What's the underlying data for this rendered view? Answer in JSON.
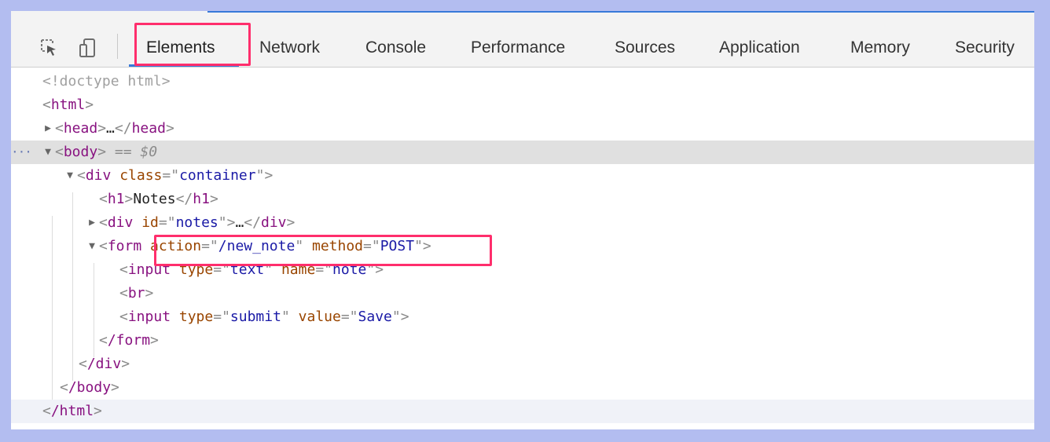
{
  "devtools": {
    "tabs": [
      {
        "label": "Elements",
        "active": true
      },
      {
        "label": "Network"
      },
      {
        "label": "Console"
      },
      {
        "label": "Performance"
      },
      {
        "label": "Sources"
      },
      {
        "label": "Application"
      },
      {
        "label": "Memory"
      },
      {
        "label": "Security"
      }
    ],
    "icons": [
      "inspect-element-icon",
      "device-toolbar-icon"
    ],
    "accent_color": "#3879d9",
    "highlight_color": "#ff2e6c"
  },
  "tree": {
    "doctype": "<!doctype html>",
    "html_open": {
      "tag": "html"
    },
    "head": {
      "tag": "head",
      "ellipsis": "…"
    },
    "body": {
      "tag": "body",
      "selected_marker": " == ",
      "var": "$0"
    },
    "container_div": {
      "tag": "div",
      "attr_name": "class",
      "attr_value": "container"
    },
    "h1": {
      "tag": "h1",
      "text": "Notes"
    },
    "notes_div": {
      "tag": "div",
      "attr_name": "id",
      "attr_value": "notes",
      "ellipsis": "…"
    },
    "form": {
      "tag": "form",
      "attr1_name": "action",
      "attr1_value": "/new_note",
      "attr2_name": "method",
      "attr2_value": "POST"
    },
    "input_text": {
      "tag": "input",
      "attr1_name": "type",
      "attr1_value": "text",
      "attr2_name": "name",
      "attr2_value": "note"
    },
    "br": {
      "tag": "br"
    },
    "input_submit": {
      "tag": "input",
      "attr1_name": "type",
      "attr1_value": "submit",
      "attr2_name": "value",
      "attr2_value": "Save"
    },
    "form_close": {
      "tag": "/form"
    },
    "div_close": {
      "tag": "/div"
    },
    "body_close": {
      "tag": "/body"
    },
    "html_close": {
      "tag": "/html"
    }
  }
}
